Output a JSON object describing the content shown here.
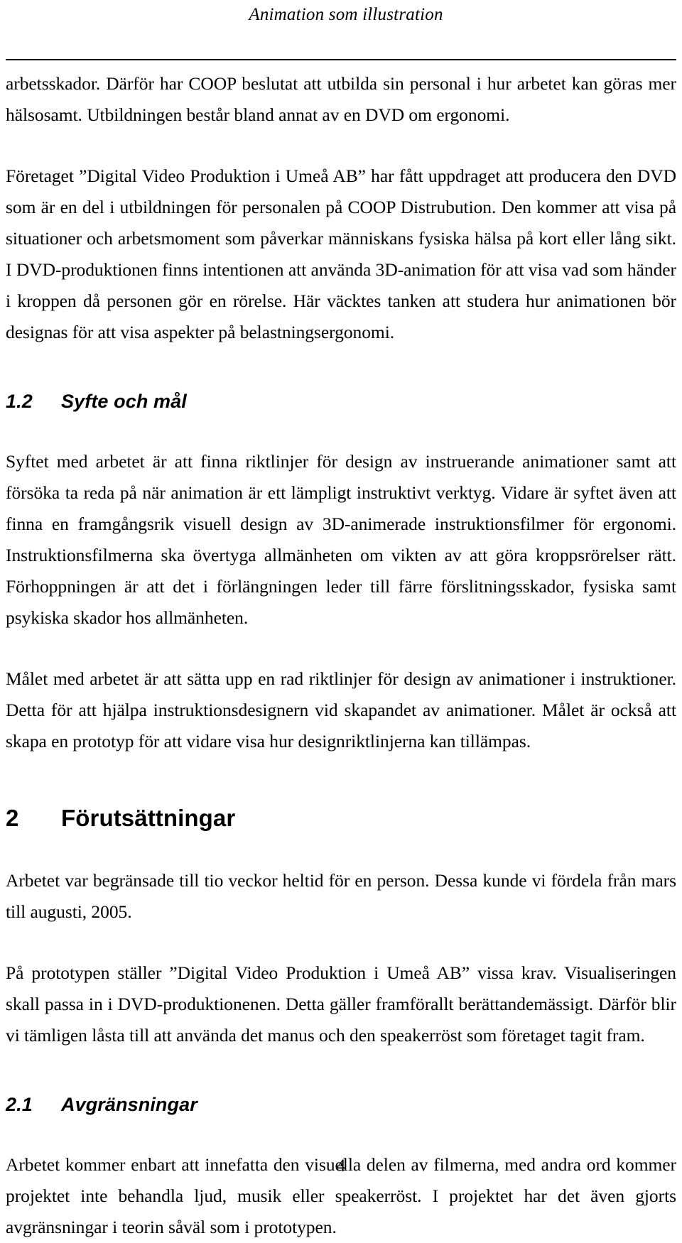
{
  "document": {
    "running_head": "Animation som illustration",
    "page_number": "4",
    "language": "sv"
  },
  "blocks": {
    "para_intro_cont": "arbetsskador. Därför har COOP beslutat att utbilda sin personal i hur arbetet kan göras mer hälsosamt. Utbildningen består bland annat av en DVD om ergonomi.",
    "para_foretaget": "Företaget ”Digital Video Produktion i Umeå AB” har fått uppdraget att producera den DVD som är en del i utbildningen för personalen på COOP Distrubution. Den kommer att visa på situationer och arbetsmoment som påverkar människans fysiska hälsa på kort eller lång sikt. I DVD-produktionen finns intentionen att använda 3D-animation för att visa vad som händer i kroppen då personen gör en rörelse. Här väcktes tanken att studera hur animationen bör designas för att visa aspekter på belastningsergonomi.",
    "heading_1_2": {
      "number": "1.2",
      "title": "Syfte och mål"
    },
    "para_syfte": "Syftet med arbetet är att finna riktlinjer för design av instruerande animationer samt att försöka ta reda på när animation är ett lämpligt instruktivt verktyg. Vidare är syftet även att finna en framgångsrik visuell design av 3D-animerade instruktionsfilmer för ergonomi. Instruktionsfilmerna ska övertyga allmänheten om vikten av att göra kroppsrörelser rätt. Förhoppningen är att det i förlängningen leder till färre förslitningsskador, fysiska samt psykiska skador hos allmänheten.",
    "para_malet": "Målet med arbetet är att sätta upp en rad riktlinjer för design av animationer i instruktioner. Detta för att hjälpa instruktionsdesignern vid skapandet av animationer. Målet är också att skapa en prototyp för att vidare visa hur designriktlinjerna kan tillämpas.",
    "heading_2": {
      "number": "2",
      "title": "Förutsättningar"
    },
    "para_arbetet_var": "Arbetet var begränsade till tio veckor heltid för en person. Dessa kunde vi fördela från mars till augusti, 2005.",
    "para_prototypen": "På prototypen ställer ”Digital Video Produktion i Umeå AB” vissa krav. Visualiseringen skall passa in i DVD-produktionenen. Detta gäller framförallt berättandemässigt. Därför blir vi tämligen låsta till att använda det manus och den speakerröst som företaget tagit fram.",
    "heading_2_1": {
      "number": "2.1",
      "title": "Avgränsningar"
    },
    "para_avgransningar": "Arbetet kommer enbart att innefatta den visuella delen av filmerna, med andra ord kommer projektet inte behandla ljud, musik eller speakerröst. I projektet har det även gjorts avgränsningar i teorin såväl som i prototypen."
  }
}
